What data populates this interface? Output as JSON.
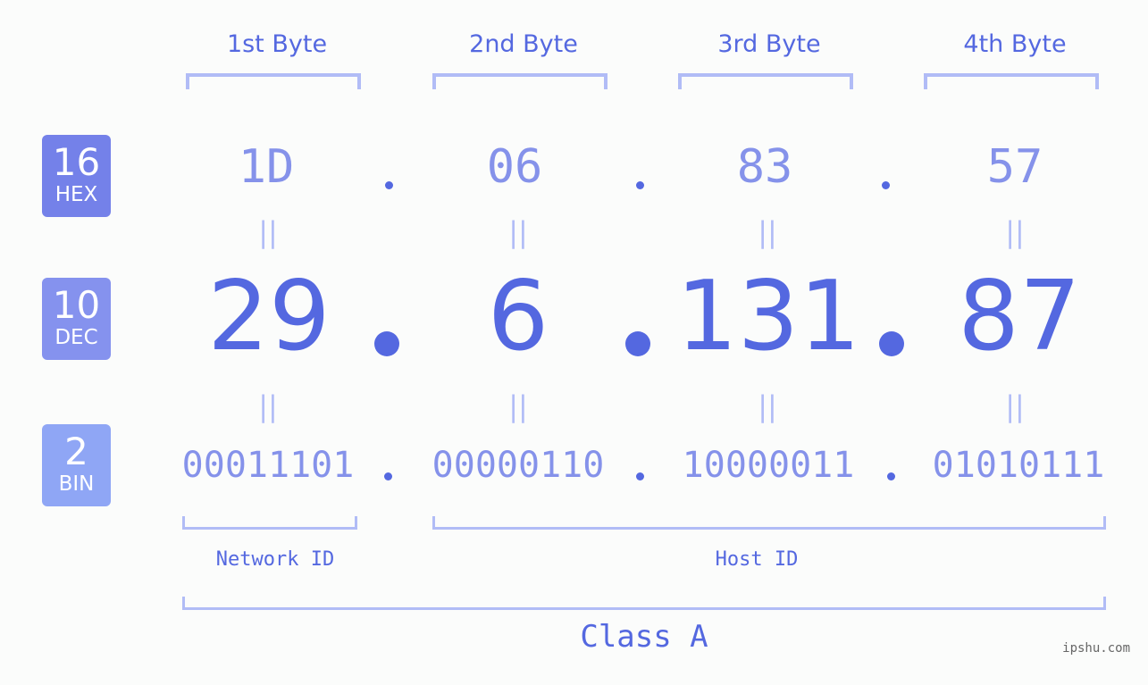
{
  "bases": [
    {
      "number": "16",
      "label": "HEX",
      "color": "#7481e9"
    },
    {
      "number": "10",
      "label": "DEC",
      "color": "#8592ee"
    },
    {
      "number": "2",
      "label": "BIN",
      "color": "#8fa6f5"
    }
  ],
  "bytes": [
    {
      "label": "1st Byte",
      "hex": "1D",
      "dec": "29",
      "bin": "00011101"
    },
    {
      "label": "2nd Byte",
      "hex": "06",
      "dec": "6",
      "bin": "00000110"
    },
    {
      "label": "3rd Byte",
      "hex": "83",
      "dec": "131",
      "bin": "10000011"
    },
    {
      "label": "4th Byte",
      "hex": "57",
      "dec": "87",
      "bin": "01010111"
    }
  ],
  "equals_symbol": "||",
  "parts": {
    "network": "Network ID",
    "host": "Host ID"
  },
  "ip_class": "Class A",
  "watermark": "ipshu.com",
  "colors": {
    "accent": "#5468e0",
    "light": "#8592ea",
    "bracket": "#b1bcf6",
    "background": "#fbfcfb"
  }
}
